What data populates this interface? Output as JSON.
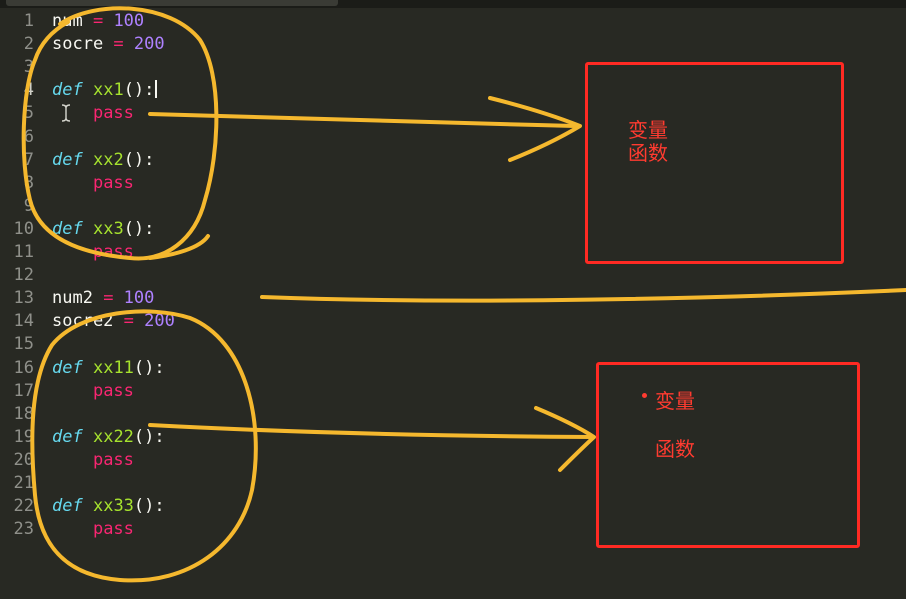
{
  "editor": {
    "lines": [
      {
        "n": "1",
        "parts": [
          {
            "t": "num",
            "c": "p"
          },
          {
            "t": " = ",
            "c": "op"
          },
          {
            "t": "100",
            "c": "num"
          }
        ]
      },
      {
        "n": "2",
        "parts": [
          {
            "t": "socre",
            "c": "p"
          },
          {
            "t": " = ",
            "c": "op"
          },
          {
            "t": "200",
            "c": "num"
          }
        ]
      },
      {
        "n": "3",
        "parts": []
      },
      {
        "n": "4",
        "active": true,
        "parts": [
          {
            "t": "def",
            "c": "kw"
          },
          {
            "t": " ",
            "c": "p"
          },
          {
            "t": "xx1",
            "c": "fn"
          },
          {
            "t": "():",
            "c": "p"
          }
        ]
      },
      {
        "n": "5",
        "parts": [
          {
            "t": "    ",
            "c": "p"
          },
          {
            "t": "pass",
            "c": "pass"
          }
        ]
      },
      {
        "n": "6",
        "parts": []
      },
      {
        "n": "7",
        "parts": [
          {
            "t": "def",
            "c": "kw"
          },
          {
            "t": " ",
            "c": "p"
          },
          {
            "t": "xx2",
            "c": "fn"
          },
          {
            "t": "():",
            "c": "p"
          }
        ]
      },
      {
        "n": "8",
        "parts": [
          {
            "t": "    ",
            "c": "p"
          },
          {
            "t": "pass",
            "c": "pass"
          }
        ]
      },
      {
        "n": "9",
        "parts": []
      },
      {
        "n": "10",
        "parts": [
          {
            "t": "def",
            "c": "kw"
          },
          {
            "t": " ",
            "c": "p"
          },
          {
            "t": "xx3",
            "c": "fn"
          },
          {
            "t": "():",
            "c": "p"
          }
        ]
      },
      {
        "n": "11",
        "parts": [
          {
            "t": "    ",
            "c": "p"
          },
          {
            "t": "pass",
            "c": "pass"
          }
        ]
      },
      {
        "n": "12",
        "parts": []
      },
      {
        "n": "13",
        "parts": [
          {
            "t": "num2",
            "c": "p"
          },
          {
            "t": " = ",
            "c": "op"
          },
          {
            "t": "100",
            "c": "num"
          }
        ]
      },
      {
        "n": "14",
        "parts": [
          {
            "t": "socre2",
            "c": "p"
          },
          {
            "t": " = ",
            "c": "op"
          },
          {
            "t": "200",
            "c": "num"
          }
        ]
      },
      {
        "n": "15",
        "parts": []
      },
      {
        "n": "16",
        "parts": [
          {
            "t": "def",
            "c": "kw"
          },
          {
            "t": " ",
            "c": "p"
          },
          {
            "t": "xx11",
            "c": "fn"
          },
          {
            "t": "():",
            "c": "p"
          }
        ]
      },
      {
        "n": "17",
        "parts": [
          {
            "t": "    ",
            "c": "p"
          },
          {
            "t": "pass",
            "c": "pass"
          }
        ]
      },
      {
        "n": "18",
        "parts": []
      },
      {
        "n": "19",
        "parts": [
          {
            "t": "def",
            "c": "kw"
          },
          {
            "t": " ",
            "c": "p"
          },
          {
            "t": "xx22",
            "c": "fn"
          },
          {
            "t": "():",
            "c": "p"
          }
        ]
      },
      {
        "n": "20",
        "parts": [
          {
            "t": "    ",
            "c": "p"
          },
          {
            "t": "pass",
            "c": "pass"
          }
        ]
      },
      {
        "n": "21",
        "parts": []
      },
      {
        "n": "22",
        "parts": [
          {
            "t": "def",
            "c": "kw"
          },
          {
            "t": " ",
            "c": "p"
          },
          {
            "t": "xx33",
            "c": "fn"
          },
          {
            "t": "():",
            "c": "p"
          }
        ]
      },
      {
        "n": "23",
        "parts": [
          {
            "t": "    ",
            "c": "p"
          },
          {
            "t": "pass",
            "c": "pass"
          }
        ]
      }
    ],
    "cursor_line": "4"
  },
  "annotations": {
    "box1": {
      "line1": "变量",
      "line2": "函数"
    },
    "box2": {
      "line1": "变量",
      "line2": "函数"
    }
  },
  "colors": {
    "background": "#282923",
    "keyword": "#66d9ef",
    "function": "#a6e22e",
    "operator": "#f92672",
    "number": "#ae81ff",
    "ink_yellow": "#f5b82e",
    "ink_red": "#ff2a23"
  }
}
